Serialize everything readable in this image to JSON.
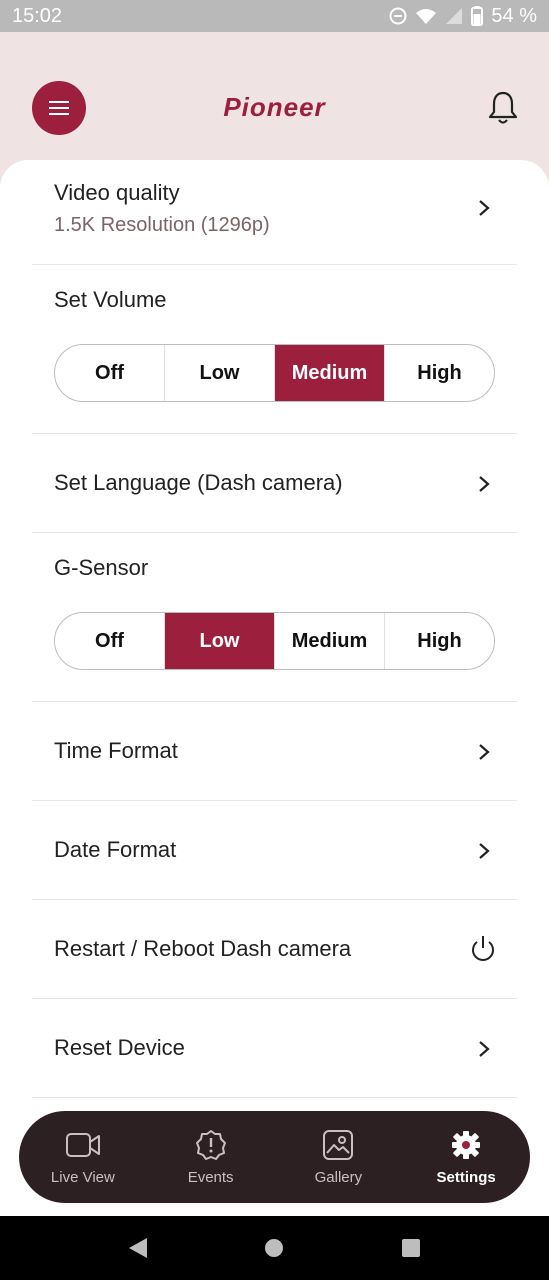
{
  "status_bar": {
    "time": "15:02",
    "battery": "54 %",
    "icons": [
      "dnd-icon",
      "wifi-icon",
      "signal-icon",
      "battery-icon"
    ]
  },
  "header": {
    "logo": "Pioneer",
    "menu_icon": "menu-icon",
    "bell_icon": "bell-icon"
  },
  "settings": {
    "video_quality": {
      "title": "Video quality",
      "subtitle": "1.5K Resolution (1296p)"
    },
    "volume": {
      "title": "Set Volume",
      "options": [
        "Off",
        "Low",
        "Medium",
        "High"
      ],
      "selected": "Medium"
    },
    "language": {
      "title": "Set Language (Dash camera)"
    },
    "gsensor": {
      "title": "G-Sensor",
      "options": [
        "Off",
        "Low",
        "Medium",
        "High"
      ],
      "selected": "Low"
    },
    "time_format": {
      "title": "Time Format"
    },
    "date_format": {
      "title": "Date Format"
    },
    "restart": {
      "title": "Restart / Reboot Dash camera"
    },
    "reset": {
      "title": "Reset Device"
    }
  },
  "bottom_nav": {
    "items": [
      {
        "label": "Live View",
        "icon": "video-camera-icon"
      },
      {
        "label": "Events",
        "icon": "alert-badge-icon"
      },
      {
        "label": "Gallery",
        "icon": "gallery-icon"
      },
      {
        "label": "Settings",
        "icon": "gear-icon"
      }
    ],
    "active": "Settings"
  },
  "colors": {
    "accent": "#9c1f3d",
    "header_bg": "#efe3e4",
    "nav_bg": "#2c2023"
  }
}
